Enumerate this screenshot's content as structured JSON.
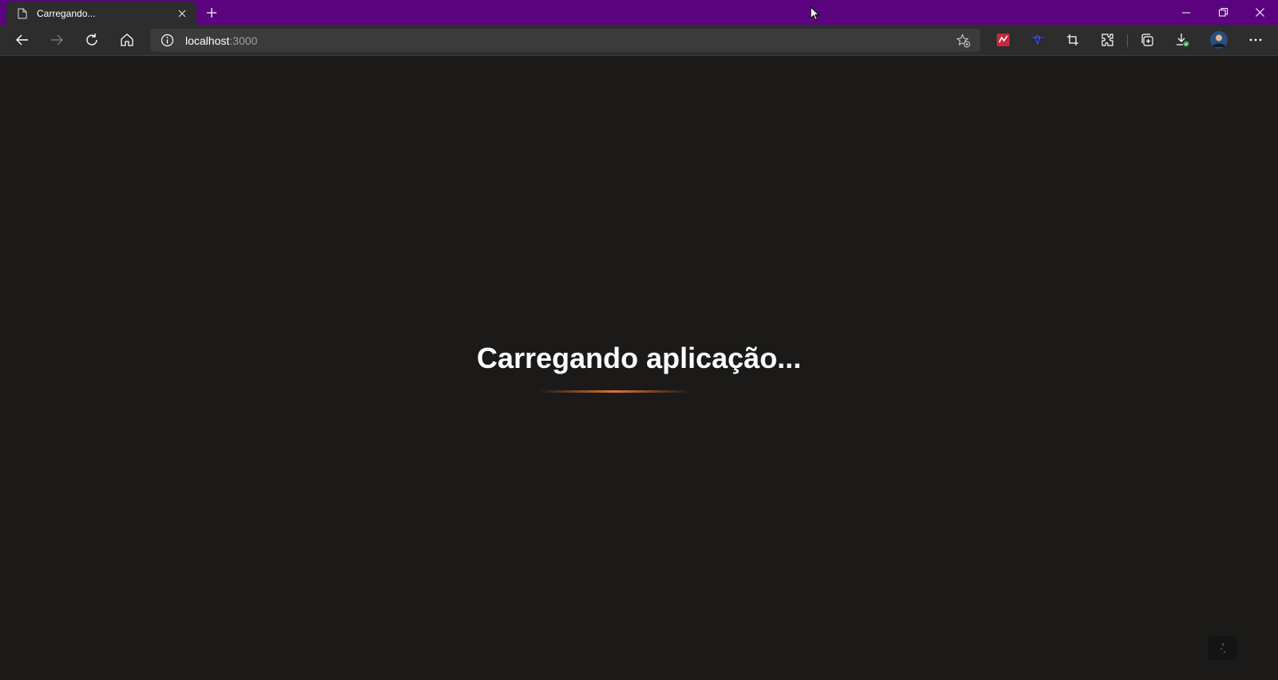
{
  "browser": {
    "tab": {
      "title": "Carregando...",
      "icon": "page-icon"
    },
    "new_tab_icon": "plus-icon",
    "window_controls": [
      "minimize-icon",
      "restore-icon",
      "close-icon"
    ],
    "address": {
      "host": "localhost",
      "port": ":3000"
    },
    "extensions": [
      "red-extension-icon",
      "blue-diamond-extension-icon",
      "screenshot-icon",
      "puzzle-extensions-icon"
    ],
    "colors": {
      "frame": "#5c0480",
      "toolbar": "#2d2d2d",
      "page_bg": "#1b1a19"
    }
  },
  "page": {
    "loading_text": "Carregando aplicação...",
    "accent_color": "#e2742d"
  }
}
